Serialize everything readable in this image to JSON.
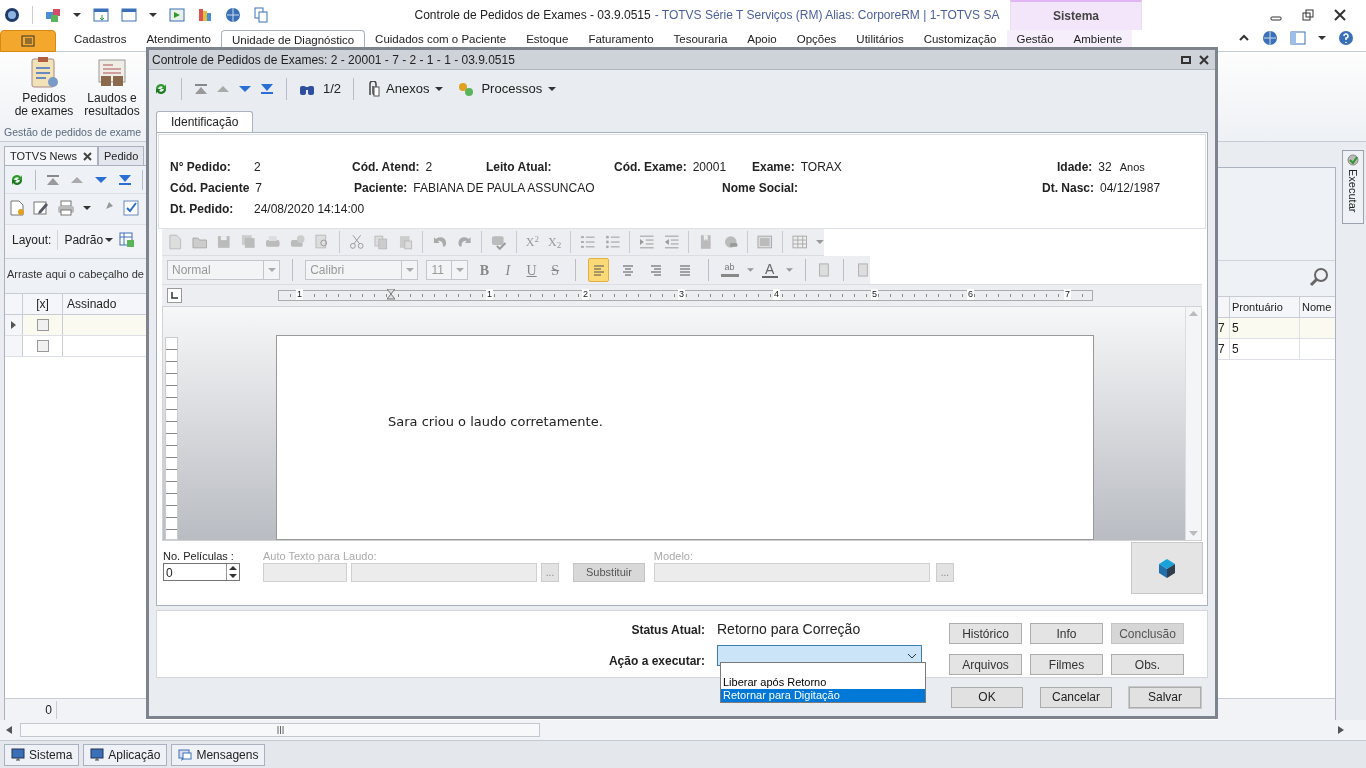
{
  "window": {
    "title": "Controle de Pedidos de Exames - 03.9.0515",
    "subtitle": "- TOTVS Série T Serviços (RM) Alias: CorporeRM | 1-TOTVS SA",
    "context_tab": "Sistema"
  },
  "ribbon_tabs": [
    {
      "label": "Cadastros",
      "selected": false
    },
    {
      "label": "Atendimento",
      "selected": false
    },
    {
      "label": "Unidade de Diagnóstico",
      "selected": true
    },
    {
      "label": "Cuidados com o Paciente",
      "selected": false
    },
    {
      "label": "Estoque",
      "selected": false
    },
    {
      "label": "Faturamento",
      "selected": false
    },
    {
      "label": "Tesouraria",
      "selected": false
    },
    {
      "label": "Apoio",
      "selected": false
    },
    {
      "label": "Opções",
      "selected": false
    },
    {
      "label": "Utilitários",
      "selected": false
    },
    {
      "label": "Customização",
      "selected": false
    },
    {
      "label": "Gestão",
      "selected": false
    },
    {
      "label": "Ambiente",
      "selected": false
    }
  ],
  "ribbon_buttons": [
    {
      "label": "Pedidos\nde exames",
      "kind": "clipboard"
    },
    {
      "label": "Laudos e\nresultados",
      "kind": "printer"
    }
  ],
  "ribbon_group": "Gestão de pedidos de exame",
  "doc_tabs": [
    {
      "label": "TOTVS News",
      "closable": true,
      "selected": true
    },
    {
      "label": "Pedido",
      "closable": false,
      "selected": false
    }
  ],
  "layout": {
    "label": "Layout:",
    "value": "Padrão"
  },
  "group_hint": "Arraste aqui o cabeçalho de",
  "grid": {
    "columns_left": [
      "[x]",
      "Assinado"
    ],
    "columns_right": [
      "Prontuário",
      "Nome"
    ],
    "rows": [
      {
        "checked": false,
        "current": true,
        "column_3": "7",
        "prontuario": "5"
      },
      {
        "checked": false,
        "current": false,
        "column_3": "7",
        "prontuario": "5"
      }
    ],
    "footer": "0"
  },
  "side_button": "Executar",
  "taskbar": [
    {
      "label": "Sistema"
    },
    {
      "label": "Aplicação"
    },
    {
      "label": "Mensagens"
    }
  ],
  "dialog": {
    "title": "Controle de Pedidos de Exames: 2 - 20001 - 7 - 2 - 1 - 1 - 03.9.0515",
    "toolbar": {
      "counter": "1/2",
      "menus": [
        "Anexos",
        "Processos"
      ]
    },
    "tabs": [
      {
        "label": "Identificação",
        "selected": true
      }
    ],
    "header_rows": [
      [
        {
          "label": "N° Pedido:",
          "value": "2"
        },
        {
          "label": "Cód. Atend:",
          "value": "2"
        },
        {
          "label": "Leito Atual:"
        },
        {
          "label": "Cód. Exame:",
          "value": "20001"
        },
        {
          "label": "Exame:",
          "value": "TORAX"
        },
        {
          "label": "Idade:",
          "value": "32",
          "unit": "Anos"
        }
      ],
      [
        {
          "label": "Cód. Paciente",
          "value": "7"
        },
        {
          "label": "Paciente:",
          "value": "FABIANA DE PAULA ASSUNCAO"
        },
        {
          "label": "Nome Social:"
        },
        {
          "label": "Dt. Nasc:",
          "value": "04/12/1987"
        }
      ],
      [
        {
          "label": "Dt. Pedido:",
          "value": "24/08/2020 14:14:00"
        }
      ]
    ],
    "editor": {
      "style": "Normal",
      "font": "Calibri",
      "size": "11",
      "format_buttons": [
        "B",
        "I",
        "U",
        "S"
      ],
      "scripts": [
        "X$^{2}$",
        "X$_{2}$"
      ],
      "align": [
        {
          "selected": true
        },
        {
          "selected": false
        },
        {
          "selected": false
        },
        {
          "selected": false
        }
      ],
      "highlight": "ab",
      "font_color": "A",
      "ruler": [
        "1",
        "1",
        "2",
        "3",
        "4",
        "5",
        "6",
        "7"
      ],
      "text": "Sara criou o laudo corretamente."
    },
    "films": {
      "label": "No. Películas :",
      "value": "0"
    },
    "auto_text": {
      "label": "Auto Texto para Laudo:",
      "button": "...",
      "replace": "Substituir"
    },
    "model": {
      "label": "Modelo:",
      "button": "..."
    },
    "status": {
      "label": "Status Atual:",
      "value": "Retorno para Correção"
    },
    "action": {
      "label": "Ação a executar:",
      "options": [
        {
          "label": "Liberar após Retorno",
          "selected": false
        },
        {
          "label": "Retornar para Digitação",
          "selected": true
        }
      ]
    },
    "side_buttons": [
      {
        "label": "Histórico",
        "disabled": false
      },
      {
        "label": "Info",
        "disabled": false
      },
      {
        "label": "Conclusão",
        "disabled": true
      },
      {
        "label": "Arquivos",
        "disabled": false
      },
      {
        "label": "Filmes",
        "disabled": false
      },
      {
        "label": "Obs.",
        "disabled": false
      }
    ],
    "buttons": [
      "OK",
      "Cancelar",
      "Salvar"
    ]
  }
}
